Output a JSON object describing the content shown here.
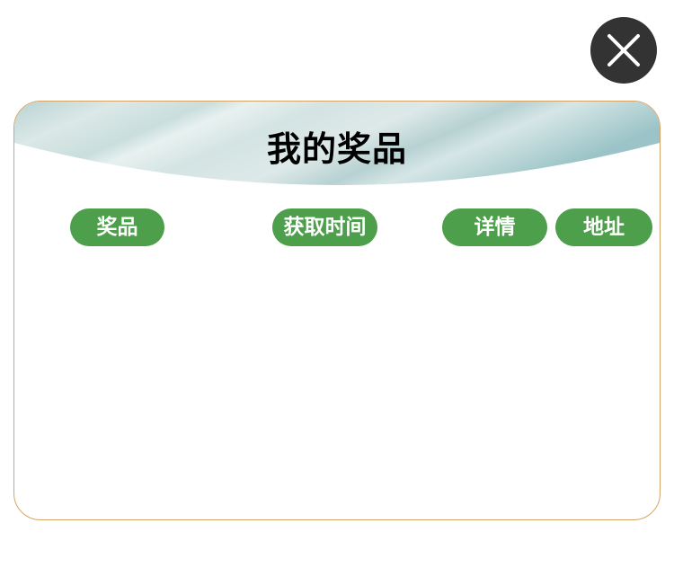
{
  "dialog": {
    "title": "我的奖品",
    "close_icon": "close-icon"
  },
  "columns": [
    {
      "label": "奖品"
    },
    {
      "label": "获取时间"
    },
    {
      "label": "详情"
    },
    {
      "label": "地址"
    }
  ],
  "prizes": [],
  "colors": {
    "accent_green": "#4e9f4b",
    "close_bg": "#333333",
    "panel_border": "#d6a468",
    "header_band_light": "#dde9e8",
    "header_band_dark": "#9cc4c8"
  }
}
